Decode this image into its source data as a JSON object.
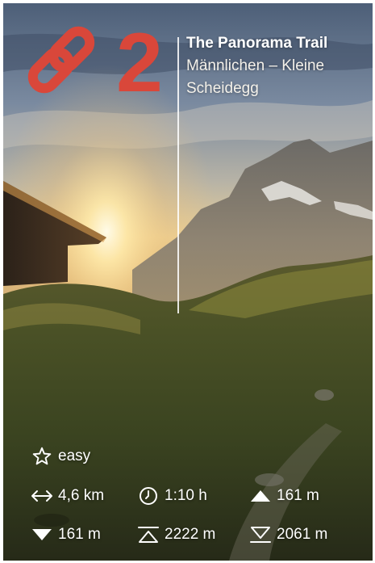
{
  "route": {
    "number": "2",
    "title": "The Panorama Trail",
    "subtitle": "Männlichen – Kleine Scheidegg"
  },
  "stats": {
    "difficulty": {
      "icon": "star-outline-icon",
      "value": "easy"
    },
    "distance": {
      "icon": "double-arrow-horizontal-icon",
      "value": "4,6 km"
    },
    "duration": {
      "icon": "clock-icon",
      "value": "1:10 h"
    },
    "ascent": {
      "icon": "triangle-up-icon",
      "value": "161 m"
    },
    "descent": {
      "icon": "triangle-down-icon",
      "value": "161 m"
    },
    "max_altitude": {
      "icon": "peak-high-icon",
      "value": "2222 m"
    },
    "min_altitude": {
      "icon": "peak-low-icon",
      "value": "2061 m"
    }
  },
  "logo": {
    "icon": "chain-link-icon"
  },
  "colors": {
    "accent": "#d9473a",
    "text": "#ffffff",
    "sky_top": "#5b6e86",
    "sky_glow": "#f3d79a",
    "meadow": "#3d4a22"
  }
}
